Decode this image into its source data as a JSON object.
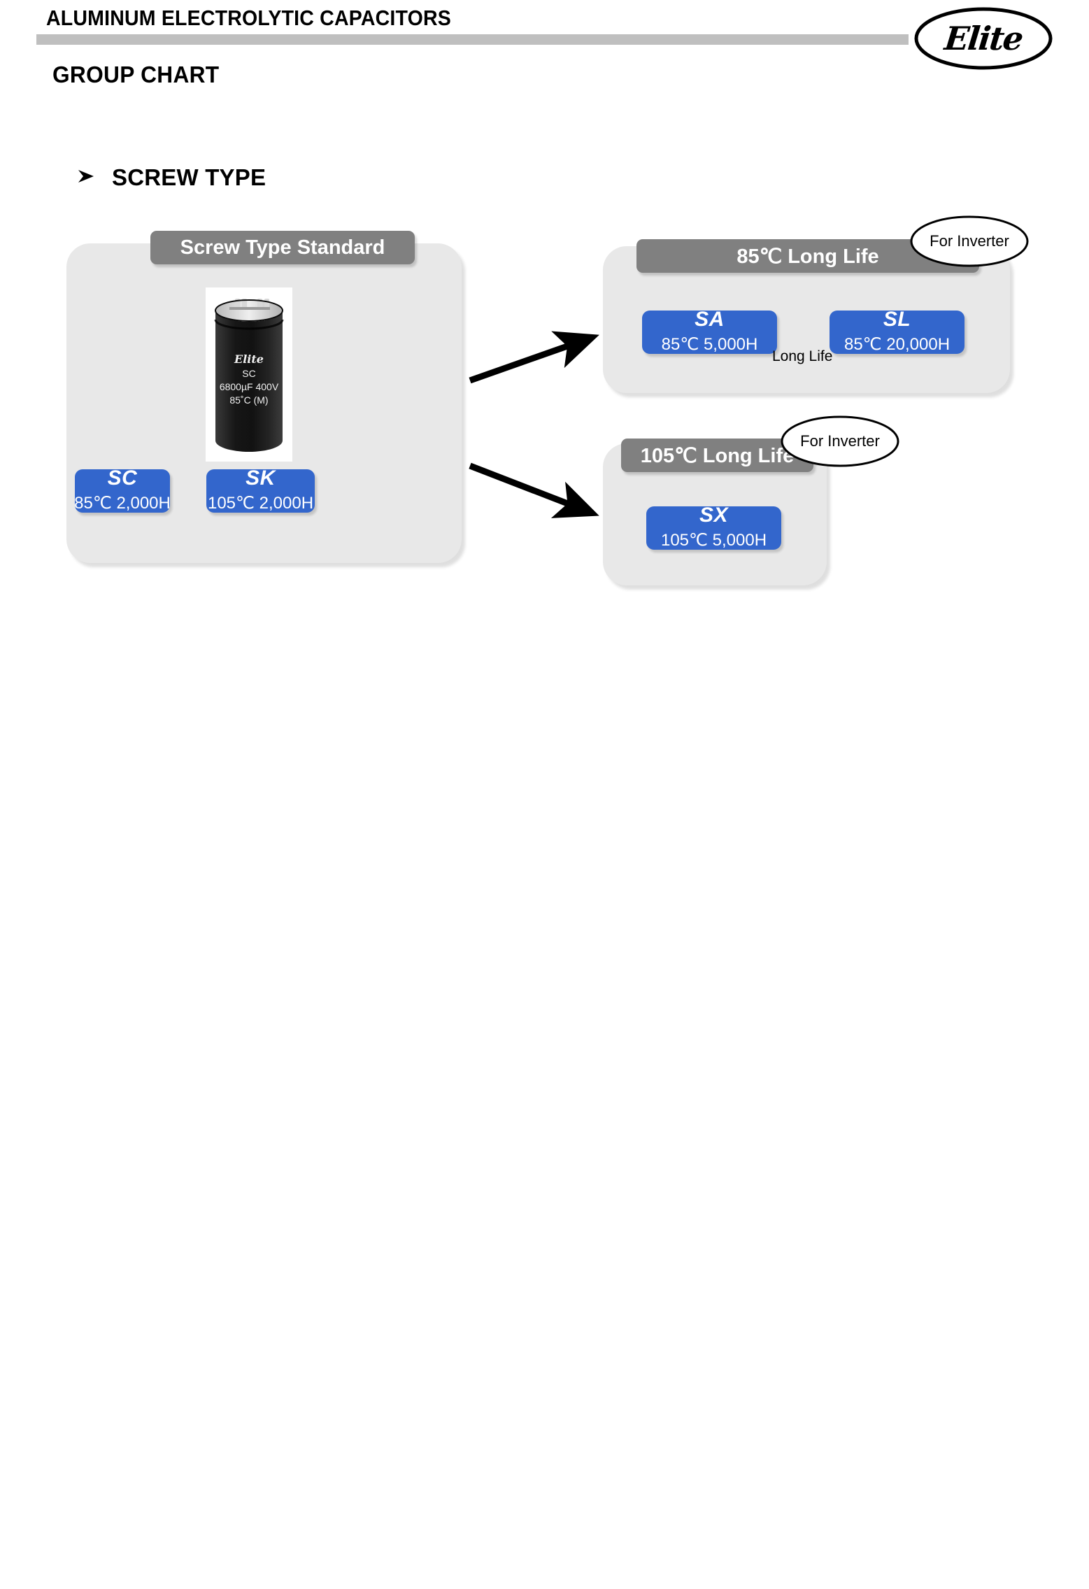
{
  "header": {
    "title": "ALUMINUM ELECTROLYTIC CAPACITORS",
    "page_title": "GROUP CHART",
    "rule_color": "#BFBFBF",
    "logo_text": "Elite",
    "logo_shape": "ellipse-outline"
  },
  "section": {
    "bullet_icon": "chevron-bullet-icon",
    "label": "SCREW TYPE"
  },
  "panels": [
    {
      "id": "screw-type-standard",
      "header": "Screw Type Standard",
      "header_color": "#808080",
      "background": "#E8E8E8",
      "photo": {
        "alt": "screw-type-capacitor-photo",
        "label_brand": "Elite",
        "label_series": "SC",
        "label_rating": "6800µF 400V",
        "label_temp": "85˚C (M)"
      },
      "chips": [
        {
          "code": "SC",
          "spec": "85℃ 2,000H"
        },
        {
          "code": "SK",
          "spec": "105℃ 2,000H"
        }
      ]
    },
    {
      "id": "85c-long-life",
      "header": "85℃ Long Life",
      "header_color": "#808080",
      "background": "#E8E8E8",
      "chips": [
        {
          "code": "SA",
          "spec": "85℃ 5,000H"
        },
        {
          "code": "SL",
          "spec": "85℃ 20,000H"
        }
      ],
      "connector_label": "Long Life"
    },
    {
      "id": "105c-long-life",
      "header": "105℃ Long Life",
      "header_color": "#808080",
      "background": "#E8E8E8",
      "chips": [
        {
          "code": "SX",
          "spec": "105℃ 5,000H"
        }
      ]
    }
  ],
  "callouts": [
    {
      "id": "callout-85c",
      "text": "For Inverter"
    },
    {
      "id": "callout-105c",
      "text": "For Inverter"
    }
  ],
  "chip_color": "#3366CC"
}
